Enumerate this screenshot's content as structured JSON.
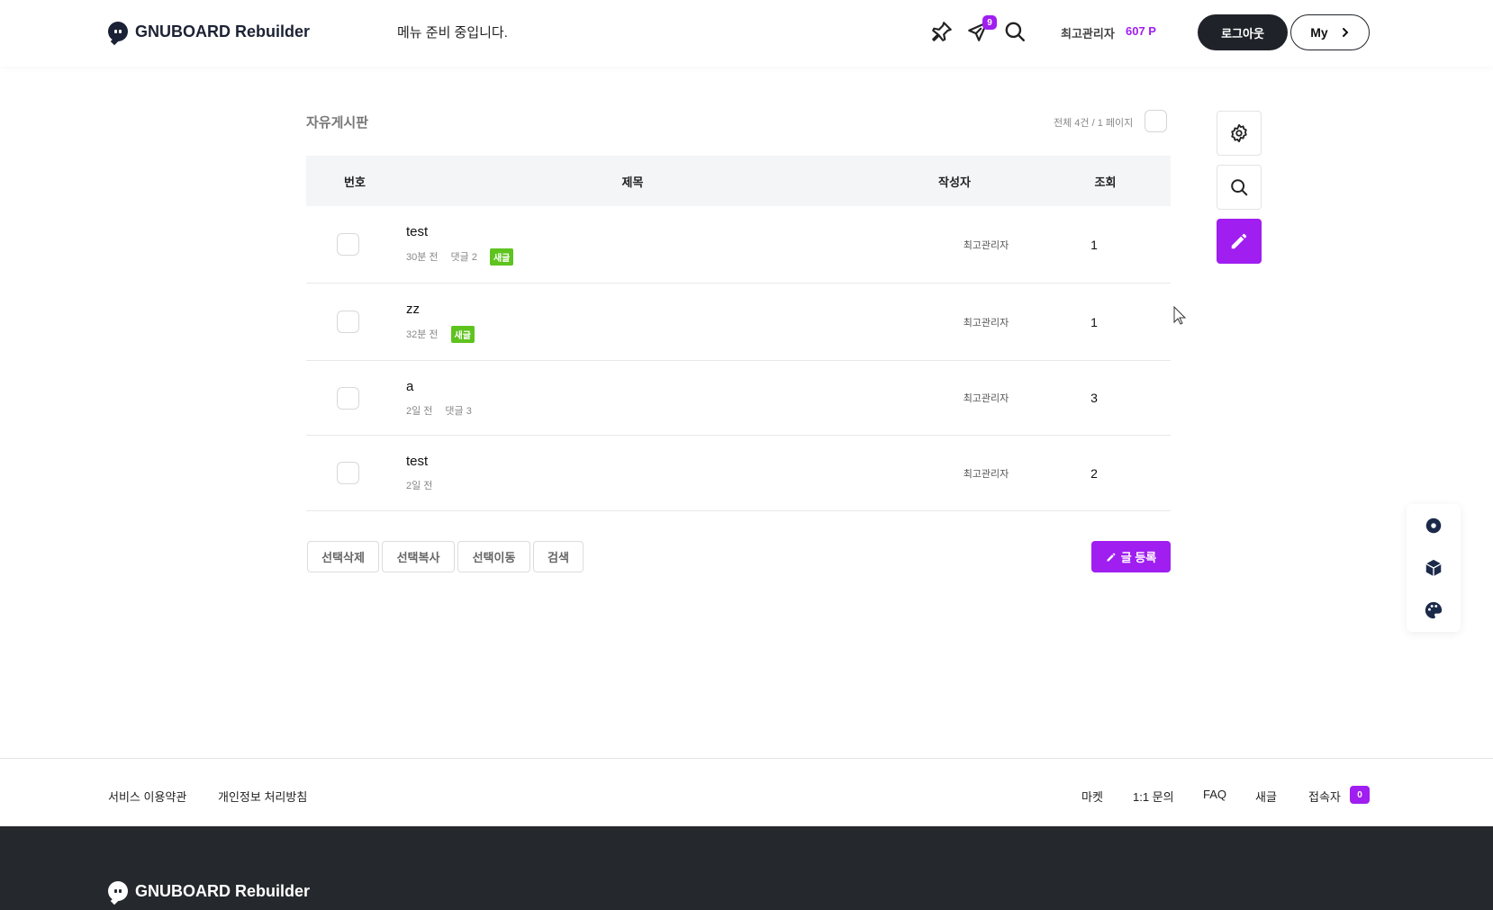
{
  "header": {
    "logo_text": "GNUBOARD Rebuilder",
    "menu_message": "메뉴 준비 중입니다.",
    "notification_count": "9",
    "user_name": "최고관리자",
    "user_points": "607 P",
    "logout_label": "로그아웃",
    "my_label": "My"
  },
  "board": {
    "title": "자유게시판",
    "count_text": "전체 4건 / 1 페이지",
    "columns": {
      "no": "번호",
      "title": "제목",
      "writer": "작성자",
      "hit": "조회"
    },
    "rows": [
      {
        "subject": "test",
        "time": "30분 전",
        "comments": "댓글 2",
        "new_label": "새글",
        "writer": "최고관리자",
        "hit": "1"
      },
      {
        "subject": "zz",
        "time": "32분 전",
        "new_label": "새글",
        "writer": "최고관리자",
        "hit": "1"
      },
      {
        "subject": "a",
        "time": "2일 전",
        "comments": "댓글 3",
        "writer": "최고관리자",
        "hit": "3"
      },
      {
        "subject": "test",
        "time": "2일 전",
        "writer": "최고관리자",
        "hit": "2"
      }
    ],
    "actions": {
      "delete": "선택삭제",
      "copy": "선택복사",
      "move": "선택이동",
      "search": "검색",
      "write": "글 등록"
    }
  },
  "side_tools": [
    "gear-icon",
    "search-icon",
    "pencil-icon"
  ],
  "float_panel": [
    "flower-icon",
    "cube-icon",
    "palette-icon"
  ],
  "footer": {
    "links_left": [
      "서비스 이용약관",
      "개인정보 처리방침"
    ],
    "links_right": [
      "마켓",
      "1:1 문의",
      "FAQ",
      "새글",
      "접속자"
    ],
    "visitor_count": "0",
    "logo_text": "GNUBOARD Rebuilder"
  },
  "colors": {
    "accent": "#a01ef0",
    "new_badge": "#5fc31f",
    "dark": "#1f2329",
    "footer_bg": "#25282c"
  }
}
